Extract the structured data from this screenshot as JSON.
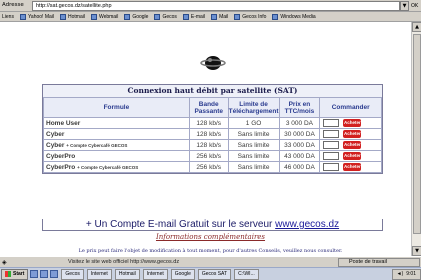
{
  "address_bar": {
    "label": "Adresse",
    "url": "http://sat.gecos.dz/satellite.php",
    "go_label": "OK"
  },
  "links_bar": {
    "label": "Liens",
    "items": [
      "Yahoo! Mail",
      "Hotmail",
      "Webmail",
      "Google",
      "Gecos",
      "E-mail",
      "Mail",
      "Gecos Info",
      "Windows Media"
    ]
  },
  "page": {
    "table_title": "Connexion haut débit par satellite (SAT)",
    "columns": {
      "formule": "Formule",
      "bandwidth": "Bande Passante",
      "dl_limit": "Limite de Téléchargement",
      "price": "Prix en TTC/mois",
      "order": "Commander"
    },
    "rows": [
      {
        "name": "Home User",
        "sub": "",
        "bandwidth": "128 kb/s",
        "limit": "1 GO",
        "price": "3 000 DA",
        "order": "Acheter"
      },
      {
        "name": "Cyber",
        "sub": "",
        "bandwidth": "128 kb/s",
        "limit": "Sans limite",
        "price": "30 000 DA",
        "order": "Acheter"
      },
      {
        "name": "Cyber",
        "sub": "+ Compte Cybercafé GECOS",
        "bandwidth": "128 kb/s",
        "limit": "Sans limite",
        "price": "33 000 DA",
        "order": "Acheter"
      },
      {
        "name": "CyberPro",
        "sub": "",
        "bandwidth": "256 kb/s",
        "limit": "Sans limite",
        "price": "43 000 DA",
        "order": "Acheter"
      },
      {
        "name": "CyberPro",
        "sub": "+ Compte Cybercafé GECOS",
        "bandwidth": "256 kb/s",
        "limit": "Sans limite",
        "price": "46 000 DA",
        "order": "Acheter"
      }
    ],
    "promo_text": "+ Un Compte E-mail Gratuit sur le serveur",
    "promo_link": "www.gecos.dz",
    "info_link": "Informations complémentaires",
    "notice": "Le prix peut faire l'objet de modification à tout moment, pour d'autres Conseils, veuillez nous consulter."
  },
  "status_bar": {
    "text": "Visitez le site web officiel http://www.gecos.dz",
    "zone": "Poste de travail"
  },
  "taskbar": {
    "start_label": "Start",
    "tasks": [
      "Gecos",
      "Internet",
      "Hotmail",
      "Internet",
      "Google",
      "Gecos SAT",
      "C:\\WI..."
    ],
    "clock": "9:01"
  },
  "colors": {
    "header_text": "#2a3b8f",
    "order_button": "#d22020",
    "frame_bg": "#eef0f8"
  }
}
